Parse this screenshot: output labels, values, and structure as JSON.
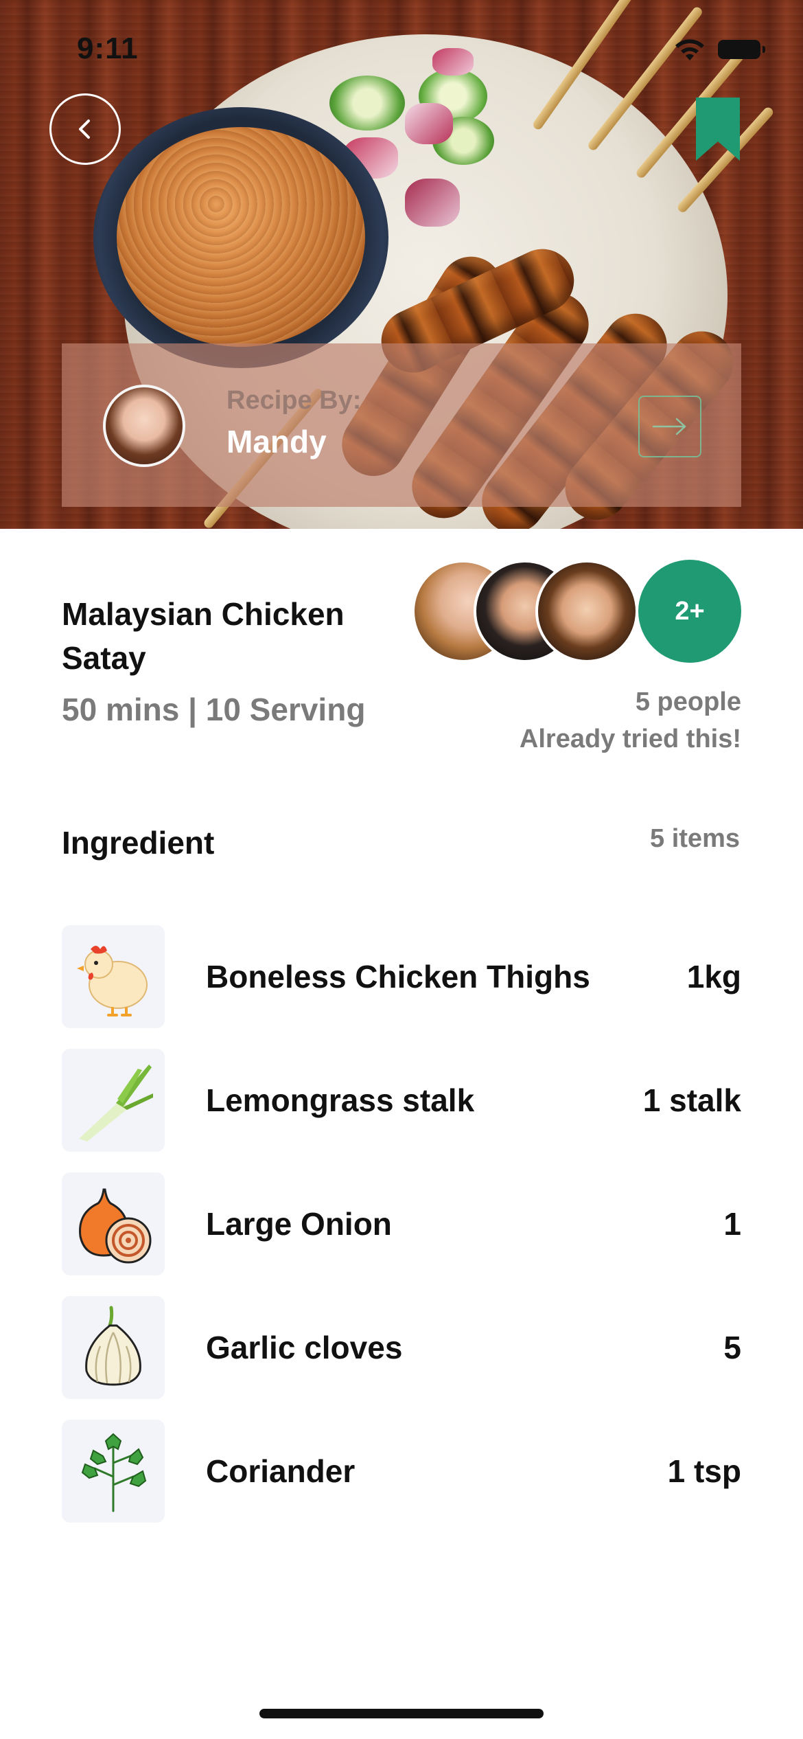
{
  "status_bar": {
    "time": "9:11"
  },
  "author": {
    "label": "Recipe By:",
    "name": "Mandy"
  },
  "recipe": {
    "title": "Malaysian Chicken Satay",
    "meta": "50 mins | 10 Serving"
  },
  "social": {
    "more_badge": "2+",
    "tried_line1": "5 people",
    "tried_line2": "Already tried this!"
  },
  "ingredients": {
    "title": "Ingredient",
    "count": "5 items",
    "items": [
      {
        "name": "Boneless Chicken Thighs",
        "qty": "1kg",
        "icon": "chicken-icon"
      },
      {
        "name": "Lemongrass stalk",
        "qty": "1 stalk",
        "icon": "lemongrass-icon"
      },
      {
        "name": "Large Onion",
        "qty": "1",
        "icon": "onion-icon"
      },
      {
        "name": "Garlic cloves",
        "qty": "5",
        "icon": "garlic-icon"
      },
      {
        "name": "Coriander",
        "qty": "1 tsp",
        "icon": "coriander-icon"
      }
    ]
  },
  "colors": {
    "accent": "#1f9a73",
    "muted_text": "#7a7a7a",
    "icon_tile": "#f3f4fa"
  }
}
